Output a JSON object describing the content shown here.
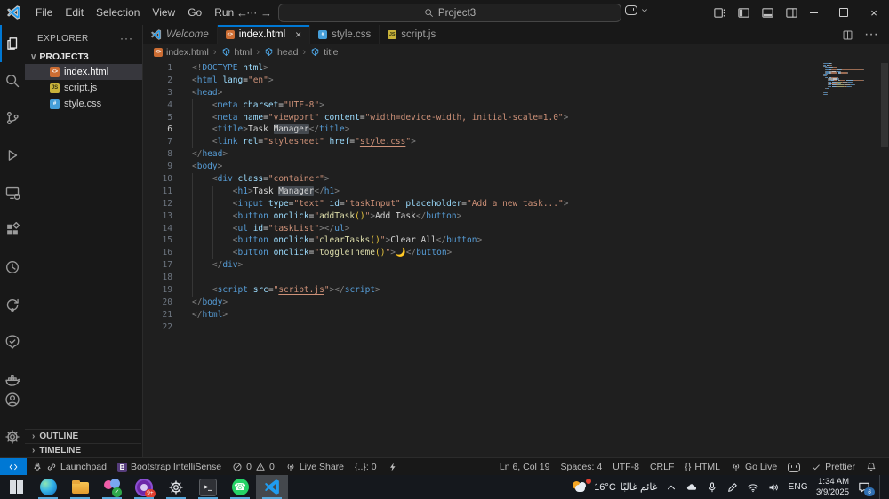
{
  "colors": {
    "accent": "#0078d4",
    "remote_bg": "#0078d4",
    "tab_active_border": "#0078d4",
    "taskbar_underline": "#57a8dc",
    "selection_bg": "#37373d",
    "syntax": {
      "tag": "#569cd6",
      "attribute": "#9cdcfe",
      "string": "#ce9178",
      "text": "#d4d4d4",
      "punctuation": "#808080",
      "function": "#dcdcaa",
      "bracket": "#e9c63d"
    }
  },
  "title_bar": {
    "menus": [
      "File",
      "Edit",
      "Selection",
      "View",
      "Go",
      "Run",
      "···"
    ],
    "back_arrow": "←",
    "forward_arrow": "→",
    "search": "Project3"
  },
  "activity_bar": {
    "top": [
      {
        "id": "explorer",
        "active": true
      },
      {
        "id": "search"
      },
      {
        "id": "source-control"
      },
      {
        "id": "run-debug"
      },
      {
        "id": "remote-explorer"
      },
      {
        "id": "extensions"
      },
      {
        "id": "history"
      },
      {
        "id": "redo-tool"
      },
      {
        "id": "approvals"
      },
      {
        "id": "docker"
      }
    ],
    "bottom": [
      {
        "id": "account"
      },
      {
        "id": "settings"
      }
    ]
  },
  "explorer": {
    "title": "EXPLORER",
    "more": "···",
    "project": "PROJECT3",
    "files": [
      {
        "name": "index.html",
        "type": "html",
        "selected": true
      },
      {
        "name": "script.js",
        "type": "js",
        "selected": false
      },
      {
        "name": "style.css",
        "type": "css",
        "selected": false
      }
    ],
    "sections": [
      "OUTLINE",
      "TIMELINE"
    ]
  },
  "tabs": [
    {
      "label": "Welcome",
      "type": "vscode",
      "italic": true,
      "active": false
    },
    {
      "label": "index.html",
      "type": "html",
      "active": true,
      "close": "×"
    },
    {
      "label": "style.css",
      "type": "css",
      "active": false
    },
    {
      "label": "script.js",
      "type": "js",
      "active": false
    }
  ],
  "breadcrumb": [
    "index.html",
    "html",
    "head",
    "title"
  ],
  "editor": {
    "current_line": 6,
    "lines": [
      {
        "n": 1,
        "g": [],
        "t": [
          [
            "p",
            "<!"
          ],
          [
            "t",
            "DOCTYPE"
          ],
          [
            "a",
            " html"
          ],
          [
            "p",
            ">"
          ]
        ]
      },
      {
        "n": 2,
        "g": [],
        "t": [
          [
            "p",
            "<"
          ],
          [
            "t",
            "html"
          ],
          [
            "x",
            " "
          ],
          [
            "a",
            "lang"
          ],
          [
            "x",
            "="
          ],
          [
            "s",
            "\"en\""
          ],
          [
            "p",
            ">"
          ]
        ]
      },
      {
        "n": 3,
        "g": [],
        "t": [
          [
            "p",
            "<"
          ],
          [
            "t",
            "head"
          ],
          [
            "p",
            ">"
          ]
        ]
      },
      {
        "n": 4,
        "g": [
          0
        ],
        "t": [
          [
            "x",
            "    "
          ],
          [
            "p",
            "<"
          ],
          [
            "t",
            "meta"
          ],
          [
            "x",
            " "
          ],
          [
            "a",
            "charset"
          ],
          [
            "x",
            "="
          ],
          [
            "s",
            "\"UTF-8\""
          ],
          [
            "p",
            ">"
          ]
        ]
      },
      {
        "n": 5,
        "g": [
          0
        ],
        "t": [
          [
            "x",
            "    "
          ],
          [
            "p",
            "<"
          ],
          [
            "t",
            "meta"
          ],
          [
            "x",
            " "
          ],
          [
            "a",
            "name"
          ],
          [
            "x",
            "="
          ],
          [
            "s",
            "\"viewport\""
          ],
          [
            "x",
            " "
          ],
          [
            "a",
            "content"
          ],
          [
            "x",
            "="
          ],
          [
            "s",
            "\"width=device-width, initial-scale=1.0\""
          ],
          [
            "p",
            ">"
          ]
        ]
      },
      {
        "n": 6,
        "g": [
          0
        ],
        "t": [
          [
            "x",
            "    "
          ],
          [
            "p",
            "<"
          ],
          [
            "t",
            "title"
          ],
          [
            "p",
            ">"
          ],
          [
            "x",
            "Task "
          ],
          [
            "h",
            "Manager"
          ],
          [
            "p",
            "</"
          ],
          [
            "t",
            "title"
          ],
          [
            "p",
            ">"
          ]
        ]
      },
      {
        "n": 7,
        "g": [
          0
        ],
        "t": [
          [
            "x",
            "    "
          ],
          [
            "p",
            "<"
          ],
          [
            "t",
            "link"
          ],
          [
            "x",
            " "
          ],
          [
            "a",
            "rel"
          ],
          [
            "x",
            "="
          ],
          [
            "s",
            "\"stylesheet\""
          ],
          [
            "x",
            " "
          ],
          [
            "a",
            "href"
          ],
          [
            "x",
            "="
          ],
          [
            "s",
            "\""
          ],
          [
            "l",
            "style.css"
          ],
          [
            "s",
            "\""
          ],
          [
            "p",
            ">"
          ]
        ]
      },
      {
        "n": 8,
        "g": [],
        "t": [
          [
            "p",
            "</"
          ],
          [
            "t",
            "head"
          ],
          [
            "p",
            ">"
          ]
        ]
      },
      {
        "n": 9,
        "g": [],
        "t": [
          [
            "p",
            "<"
          ],
          [
            "t",
            "body"
          ],
          [
            "p",
            ">"
          ]
        ]
      },
      {
        "n": 10,
        "g": [
          0
        ],
        "t": [
          [
            "x",
            "    "
          ],
          [
            "p",
            "<"
          ],
          [
            "t",
            "div"
          ],
          [
            "x",
            " "
          ],
          [
            "a",
            "class"
          ],
          [
            "x",
            "="
          ],
          [
            "s",
            "\"container\""
          ],
          [
            "p",
            ">"
          ]
        ]
      },
      {
        "n": 11,
        "g": [
          0,
          1
        ],
        "t": [
          [
            "x",
            "        "
          ],
          [
            "p",
            "<"
          ],
          [
            "t",
            "h1"
          ],
          [
            "p",
            ">"
          ],
          [
            "x",
            "Task "
          ],
          [
            "h",
            "Manager"
          ],
          [
            "p",
            "</"
          ],
          [
            "t",
            "h1"
          ],
          [
            "p",
            ">"
          ]
        ]
      },
      {
        "n": 12,
        "g": [
          0,
          1
        ],
        "t": [
          [
            "x",
            "        "
          ],
          [
            "p",
            "<"
          ],
          [
            "t",
            "input"
          ],
          [
            "x",
            " "
          ],
          [
            "a",
            "type"
          ],
          [
            "x",
            "="
          ],
          [
            "s",
            "\"text\""
          ],
          [
            "x",
            " "
          ],
          [
            "a",
            "id"
          ],
          [
            "x",
            "="
          ],
          [
            "s",
            "\"taskInput\""
          ],
          [
            "x",
            " "
          ],
          [
            "a",
            "placeholder"
          ],
          [
            "x",
            "="
          ],
          [
            "s",
            "\"Add a new task...\""
          ],
          [
            "p",
            ">"
          ]
        ]
      },
      {
        "n": 13,
        "g": [
          0,
          1
        ],
        "t": [
          [
            "x",
            "        "
          ],
          [
            "p",
            "<"
          ],
          [
            "t",
            "button"
          ],
          [
            "x",
            " "
          ],
          [
            "a",
            "onclick"
          ],
          [
            "x",
            "="
          ],
          [
            "s",
            "\""
          ],
          [
            "f",
            "addTask"
          ],
          [
            "g2",
            "()"
          ],
          [
            "s",
            "\""
          ],
          [
            "p",
            ">"
          ],
          [
            "x",
            "Add Task"
          ],
          [
            "p",
            "</"
          ],
          [
            "t",
            "button"
          ],
          [
            "p",
            ">"
          ]
        ]
      },
      {
        "n": 14,
        "g": [
          0,
          1
        ],
        "t": [
          [
            "x",
            "        "
          ],
          [
            "p",
            "<"
          ],
          [
            "t",
            "ul"
          ],
          [
            "x",
            " "
          ],
          [
            "a",
            "id"
          ],
          [
            "x",
            "="
          ],
          [
            "s",
            "\"taskList\""
          ],
          [
            "p",
            "></"
          ],
          [
            "t",
            "ul"
          ],
          [
            "p",
            ">"
          ]
        ]
      },
      {
        "n": 15,
        "g": [
          0,
          1
        ],
        "t": [
          [
            "x",
            "        "
          ],
          [
            "p",
            "<"
          ],
          [
            "t",
            "button"
          ],
          [
            "x",
            " "
          ],
          [
            "a",
            "onclick"
          ],
          [
            "x",
            "="
          ],
          [
            "s",
            "\""
          ],
          [
            "f",
            "clearTasks"
          ],
          [
            "g2",
            "()"
          ],
          [
            "s",
            "\""
          ],
          [
            "p",
            ">"
          ],
          [
            "x",
            "Clear All"
          ],
          [
            "p",
            "</"
          ],
          [
            "t",
            "button"
          ],
          [
            "p",
            ">"
          ]
        ]
      },
      {
        "n": 16,
        "g": [
          0,
          1
        ],
        "t": [
          [
            "x",
            "        "
          ],
          [
            "p",
            "<"
          ],
          [
            "t",
            "button"
          ],
          [
            "x",
            " "
          ],
          [
            "a",
            "onclick"
          ],
          [
            "x",
            "="
          ],
          [
            "s",
            "\""
          ],
          [
            "f",
            "toggleTheme"
          ],
          [
            "g2",
            "()"
          ],
          [
            "s",
            "\""
          ],
          [
            "p",
            ">"
          ],
          [
            "e",
            "🌙"
          ],
          [
            "p",
            "</"
          ],
          [
            "t",
            "button"
          ],
          [
            "p",
            ">"
          ]
        ]
      },
      {
        "n": 17,
        "g": [
          0
        ],
        "t": [
          [
            "x",
            "    "
          ],
          [
            "p",
            "</"
          ],
          [
            "t",
            "div"
          ],
          [
            "p",
            ">"
          ]
        ]
      },
      {
        "n": 18,
        "g": [
          0
        ],
        "t": []
      },
      {
        "n": 19,
        "g": [
          0
        ],
        "t": [
          [
            "x",
            "    "
          ],
          [
            "p",
            "<"
          ],
          [
            "t",
            "script"
          ],
          [
            "x",
            " "
          ],
          [
            "a",
            "src"
          ],
          [
            "x",
            "="
          ],
          [
            "s",
            "\""
          ],
          [
            "l",
            "script.js"
          ],
          [
            "s",
            "\""
          ],
          [
            "p",
            "></"
          ],
          [
            "t",
            "script"
          ],
          [
            "p",
            ">"
          ]
        ]
      },
      {
        "n": 20,
        "g": [],
        "t": [
          [
            "p",
            "</"
          ],
          [
            "t",
            "body"
          ],
          [
            "p",
            ">"
          ]
        ]
      },
      {
        "n": 21,
        "g": [],
        "t": [
          [
            "p",
            "</"
          ],
          [
            "t",
            "html"
          ],
          [
            "p",
            ">"
          ]
        ]
      },
      {
        "n": 22,
        "g": [],
        "t": []
      }
    ]
  },
  "status_bar": {
    "left": [
      {
        "id": "remote-window",
        "parts": [
          {
            "icon": "remote"
          }
        ]
      },
      {
        "id": "launchpad",
        "parts": [
          {
            "icon": "rocket"
          },
          {
            "icon": "link"
          },
          {
            "text": "Launchpad"
          }
        ]
      },
      {
        "id": "bootstrap-intellisense",
        "parts": [
          {
            "icon": "bootstrap"
          },
          {
            "text": "Bootstrap IntelliSense"
          }
        ]
      },
      {
        "id": "problems",
        "parts": [
          {
            "icon": "error"
          },
          {
            "text": "0"
          },
          {
            "icon": "warning"
          },
          {
            "text": "0"
          }
        ]
      },
      {
        "id": "live-share",
        "parts": [
          {
            "icon": "broadcast"
          },
          {
            "text": "Live Share"
          }
        ]
      },
      {
        "id": "symbol-count",
        "parts": [
          {
            "text": "{..}: 0"
          }
        ]
      },
      {
        "id": "plug",
        "parts": [
          {
            "icon": "bolt"
          }
        ]
      }
    ],
    "right": [
      {
        "id": "cursor-position",
        "parts": [
          {
            "text": "Ln 6, Col 19"
          }
        ]
      },
      {
        "id": "indentation",
        "parts": [
          {
            "text": "Spaces: 4"
          }
        ]
      },
      {
        "id": "encoding",
        "parts": [
          {
            "text": "UTF-8"
          }
        ]
      },
      {
        "id": "eol",
        "parts": [
          {
            "text": "CRLF"
          }
        ]
      },
      {
        "id": "language-mode",
        "parts": [
          {
            "icon": "braces"
          },
          {
            "text": "HTML"
          }
        ]
      },
      {
        "id": "go-live",
        "parts": [
          {
            "icon": "tower"
          },
          {
            "text": "Go Live"
          }
        ]
      },
      {
        "id": "copilot",
        "parts": [
          {
            "icon": "copilot"
          }
        ]
      },
      {
        "id": "prettier",
        "parts": [
          {
            "icon": "check"
          },
          {
            "text": "Prettier"
          }
        ]
      },
      {
        "id": "notifications",
        "parts": [
          {
            "icon": "bell"
          }
        ]
      }
    ]
  },
  "taskbar": {
    "apps": [
      {
        "id": "start",
        "running": false
      },
      {
        "id": "edge",
        "running": true
      },
      {
        "id": "file-explorer",
        "running": true
      },
      {
        "id": "store",
        "running": true
      },
      {
        "id": "media",
        "running": true,
        "badge": "9+"
      },
      {
        "id": "settings",
        "running": true
      },
      {
        "id": "terminal",
        "running": true
      },
      {
        "id": "whatsapp",
        "running": true
      },
      {
        "id": "vscode",
        "running": true,
        "active": true
      }
    ],
    "tray": {
      "weather_temp": "16°C",
      "weather_condition": "غائم غالبًا",
      "language": "ENG",
      "time": "1:34 AM",
      "date": "3/9/2025",
      "notification_count": "6"
    }
  }
}
